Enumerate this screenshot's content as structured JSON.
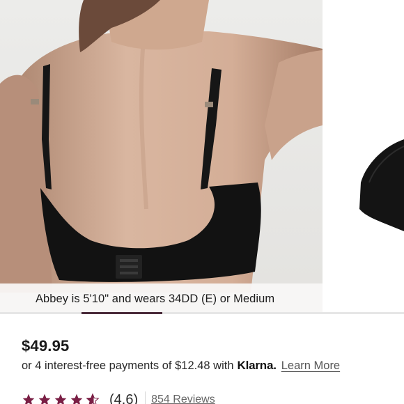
{
  "gallery": {
    "caption": "Abbey is 5'10\" and wears 34DD (E) or Medium",
    "active_slide": 2,
    "slide_count": 5
  },
  "product": {
    "price": "$49.95",
    "installments": {
      "text": "or 4 interest-free payments of $12.48 with",
      "provider": "Klarna.",
      "learn_more": "Learn More"
    },
    "rating": {
      "value": 4.6,
      "display": "(4.6)",
      "reviews": "854 Reviews"
    }
  },
  "colors": {
    "accent": "#7a1f45",
    "indicator": "#4a2a3a"
  }
}
